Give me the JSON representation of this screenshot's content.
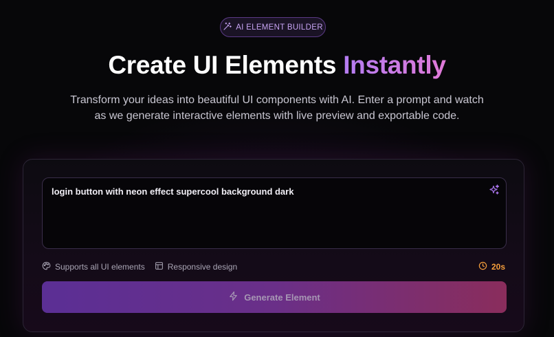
{
  "badge": {
    "label": "AI ELEMENT BUILDER",
    "icon": "magic-wand-icon"
  },
  "hero": {
    "title_main": "Create UI Elements",
    "title_accent": "Instantly",
    "subtitle_line1": "Transform your ideas into beautiful UI components with AI. Enter a prompt and watch",
    "subtitle_line2": "as we generate interactive elements with live preview and exportable code."
  },
  "prompt": {
    "value": "login button with neon effect supercool background dark",
    "icon": "sparkles-icon"
  },
  "features": [
    {
      "label": "Supports all UI elements",
      "icon": "palette-icon"
    },
    {
      "label": "Responsive design",
      "icon": "layout-icon"
    }
  ],
  "timer": {
    "label": "20s",
    "icon": "clock-icon"
  },
  "generate": {
    "label": "Generate Element",
    "icon": "lightning-icon"
  },
  "colors": {
    "background": "#070709",
    "accent_purple": "#b47cf2",
    "accent_pink": "#e07ad8",
    "timer_orange": "#f59e3b",
    "button_gradient_start": "#5b2f95",
    "button_gradient_end": "#8a2d5c"
  }
}
